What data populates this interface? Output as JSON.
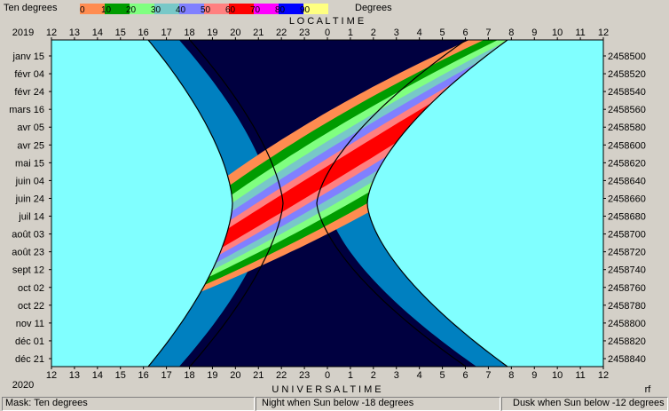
{
  "header": {
    "mask_label": "Ten degrees",
    "legend_title": "Degrees",
    "year_top": "2019",
    "year_bottom": "2020",
    "top_axis_title": "L O C A L   T I M E",
    "bottom_axis_title": "U N I V E R S A L   T I M E",
    "corner_flag": "rf"
  },
  "colorbar": {
    "labels": [
      "0",
      "10",
      "20",
      "30",
      "40",
      "50",
      "60",
      "70",
      "80",
      "90"
    ],
    "colors": [
      "#ff8c50",
      "#009c00",
      "#80ff80",
      "#78c8c8",
      "#8080ff",
      "#ff8080",
      "#ff0000",
      "#ff00ff",
      "#0000ff",
      "#ffff80"
    ]
  },
  "status": {
    "mask": "Mask:  Ten degrees",
    "night": "Night when Sun below -18 degrees",
    "dusk": "Dusk when Sun below -12 degrees"
  },
  "chart_data": {
    "type": "heatmap",
    "title": "",
    "x_top_label": "LOCAL TIME",
    "x_bottom_label": "UNIVERSAL TIME",
    "x_tick_labels": [
      "12",
      "13",
      "14",
      "15",
      "16",
      "17",
      "18",
      "19",
      "20",
      "21",
      "22",
      "23",
      "0",
      "1",
      "2",
      "3",
      "4",
      "5",
      "6",
      "7",
      "8",
      "9",
      "10",
      "11",
      "12"
    ],
    "y_left_tick_labels": [
      "janv 15",
      "févr 04",
      "févr 24",
      "mars 16",
      "avr 05",
      "avr 25",
      "mai 15",
      "juin 04",
      "juin 24",
      "juil 14",
      "août 03",
      "août 23",
      "sept 12",
      "oct 02",
      "oct 22",
      "nov 11",
      "déc 01",
      "déc 21"
    ],
    "y_right_tick_labels": [
      "2458500",
      "2458520",
      "2458540",
      "2458560",
      "2458580",
      "2458600",
      "2458620",
      "2458640",
      "2458660",
      "2458680",
      "2458700",
      "2458720",
      "2458740",
      "2458760",
      "2458780",
      "2458800",
      "2458820",
      "2458840"
    ],
    "colors": {
      "day": "#80ffff",
      "twilight": "#0080c0",
      "night": "#000040"
    }
  }
}
